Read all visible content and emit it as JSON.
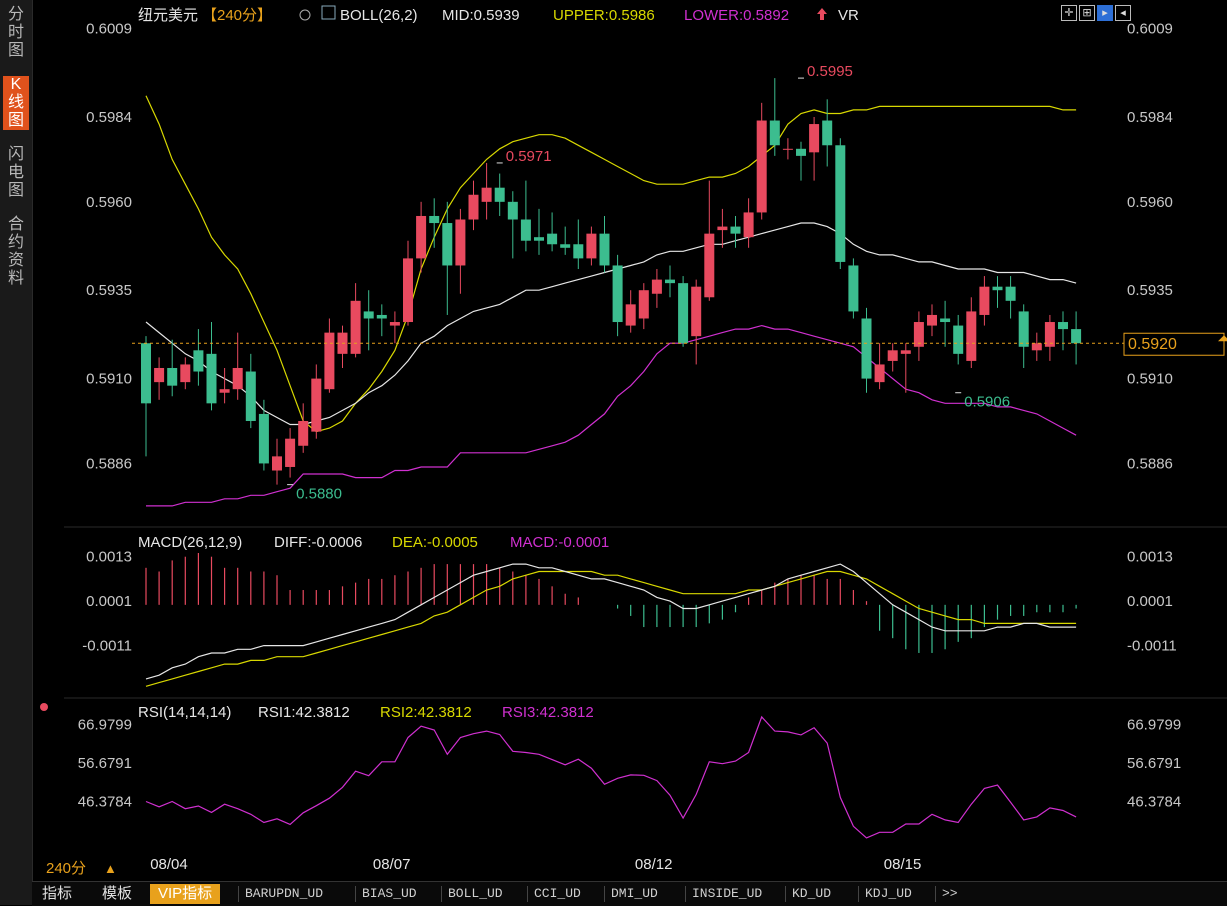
{
  "left_tabs": [
    "分时图",
    "K线图",
    "闪电图",
    "合约资料"
  ],
  "active_tab": "K线图",
  "header": {
    "symbol": "纽元美元",
    "period": "【240分】",
    "boll_label": "BOLL(26,2)",
    "mid": "MID:0.5939",
    "upper": "UPPER:0.5986",
    "lower": "LOWER:0.5892",
    "vr": "VR"
  },
  "macd_header": {
    "label": "MACD(26,12,9)",
    "diff": "DIFF:-0.0006",
    "dea": "DEA:-0.0005",
    "macd": "MACD:-0.0001"
  },
  "rsi_header": {
    "label": "RSI(14,14,14)",
    "rsi1": "RSI1:42.3812",
    "rsi2": "RSI2:42.3812",
    "rsi3": "RSI3:42.3812"
  },
  "period_button": "240分",
  "period_arrow": "▲",
  "current_price": "0.5920",
  "bottom_tabs": [
    "指标",
    "模板",
    "VIP指标",
    "BARUPDN_UD",
    "BIAS_UD",
    "BOLL_UD",
    "CCI_UD",
    "DMI_UD",
    "INSIDE_UD",
    "KD_UD",
    "KDJ_UD",
    ">>"
  ],
  "colors": {
    "up": "#e84a5f",
    "down": "#3cbd8f",
    "upper": "#d8d800",
    "mid": "#e6e6e6",
    "lower": "#d030d0",
    "price_line": "#e8a11c"
  },
  "chart_data": [
    {
      "type": "candlestick",
      "title": "纽元美元【240分】",
      "y_ticks": [
        "0.6009",
        "0.5984",
        "0.5960",
        "0.5935",
        "0.5910",
        "0.5886"
      ],
      "ylim": [
        0.587,
        0.6012
      ],
      "x_tick_labels": [
        {
          "label": "08/04",
          "index": 2
        },
        {
          "label": "08/07",
          "index": 19
        },
        {
          "label": "08/12",
          "index": 39
        },
        {
          "label": "08/15",
          "index": 58
        }
      ],
      "annotations": [
        {
          "text": "0.5995",
          "index": 50,
          "value": 0.5995
        },
        {
          "text": "0.5971",
          "index": 27,
          "value": 0.5971
        },
        {
          "text": "0.5880",
          "index": 11,
          "value": 0.588
        },
        {
          "text": "0.5906",
          "index": 62,
          "value": 0.5906
        }
      ],
      "candles": [
        {
          "o": 0.592,
          "c": 0.5903,
          "h": 0.5922,
          "l": 0.5888
        },
        {
          "o": 0.5909,
          "c": 0.5913,
          "h": 0.5916,
          "l": 0.5904
        },
        {
          "o": 0.5913,
          "c": 0.5908,
          "h": 0.5921,
          "l": 0.5905
        },
        {
          "o": 0.5909,
          "c": 0.5914,
          "h": 0.5916,
          "l": 0.5907
        },
        {
          "o": 0.5918,
          "c": 0.5912,
          "h": 0.5924,
          "l": 0.5908
        },
        {
          "o": 0.5917,
          "c": 0.5903,
          "h": 0.5926,
          "l": 0.5901
        },
        {
          "o": 0.5906,
          "c": 0.5907,
          "h": 0.5913,
          "l": 0.5903
        },
        {
          "o": 0.5907,
          "c": 0.5913,
          "h": 0.5923,
          "l": 0.5904
        },
        {
          "o": 0.5912,
          "c": 0.5898,
          "h": 0.5917,
          "l": 0.5896
        },
        {
          "o": 0.59,
          "c": 0.5886,
          "h": 0.5904,
          "l": 0.5884
        },
        {
          "o": 0.5884,
          "c": 0.5888,
          "h": 0.5893,
          "l": 0.588
        },
        {
          "o": 0.5885,
          "c": 0.5893,
          "h": 0.5896,
          "l": 0.5882
        },
        {
          "o": 0.5891,
          "c": 0.5898,
          "h": 0.5903,
          "l": 0.5889
        },
        {
          "o": 0.5895,
          "c": 0.591,
          "h": 0.5914,
          "l": 0.5893
        },
        {
          "o": 0.5907,
          "c": 0.5923,
          "h": 0.5927,
          "l": 0.5906
        },
        {
          "o": 0.5917,
          "c": 0.5923,
          "h": 0.5925,
          "l": 0.5913
        },
        {
          "o": 0.5917,
          "c": 0.5932,
          "h": 0.5937,
          "l": 0.5916
        },
        {
          "o": 0.5929,
          "c": 0.5927,
          "h": 0.5935,
          "l": 0.5918
        },
        {
          "o": 0.5928,
          "c": 0.5927,
          "h": 0.5931,
          "l": 0.5922
        },
        {
          "o": 0.5925,
          "c": 0.5926,
          "h": 0.5929,
          "l": 0.592
        },
        {
          "o": 0.5926,
          "c": 0.5944,
          "h": 0.5949,
          "l": 0.5925
        },
        {
          "o": 0.5944,
          "c": 0.5956,
          "h": 0.596,
          "l": 0.594
        },
        {
          "o": 0.5956,
          "c": 0.5954,
          "h": 0.5961,
          "l": 0.5947
        },
        {
          "o": 0.5954,
          "c": 0.5942,
          "h": 0.596,
          "l": 0.5928
        },
        {
          "o": 0.5942,
          "c": 0.5955,
          "h": 0.5958,
          "l": 0.5934
        },
        {
          "o": 0.5955,
          "c": 0.5962,
          "h": 0.5966,
          "l": 0.5952
        },
        {
          "o": 0.596,
          "c": 0.5964,
          "h": 0.5971,
          "l": 0.5955
        },
        {
          "o": 0.5964,
          "c": 0.596,
          "h": 0.5968,
          "l": 0.5956
        },
        {
          "o": 0.596,
          "c": 0.5955,
          "h": 0.5963,
          "l": 0.5944
        },
        {
          "o": 0.5955,
          "c": 0.5949,
          "h": 0.5966,
          "l": 0.5946
        },
        {
          "o": 0.595,
          "c": 0.5949,
          "h": 0.5958,
          "l": 0.5945
        },
        {
          "o": 0.5951,
          "c": 0.5948,
          "h": 0.5957,
          "l": 0.5946
        },
        {
          "o": 0.5948,
          "c": 0.5947,
          "h": 0.5953,
          "l": 0.5945
        },
        {
          "o": 0.5948,
          "c": 0.5944,
          "h": 0.5955,
          "l": 0.5941
        },
        {
          "o": 0.5944,
          "c": 0.5951,
          "h": 0.5953,
          "l": 0.5942
        },
        {
          "o": 0.5951,
          "c": 0.5942,
          "h": 0.5956,
          "l": 0.594
        },
        {
          "o": 0.5942,
          "c": 0.5926,
          "h": 0.5945,
          "l": 0.5922
        },
        {
          "o": 0.5925,
          "c": 0.5931,
          "h": 0.5935,
          "l": 0.5923
        },
        {
          "o": 0.5927,
          "c": 0.5935,
          "h": 0.5937,
          "l": 0.5924
        },
        {
          "o": 0.5934,
          "c": 0.5938,
          "h": 0.5941,
          "l": 0.593
        },
        {
          "o": 0.5938,
          "c": 0.5937,
          "h": 0.5942,
          "l": 0.5933
        },
        {
          "o": 0.5937,
          "c": 0.592,
          "h": 0.5939,
          "l": 0.5919
        },
        {
          "o": 0.5922,
          "c": 0.5936,
          "h": 0.5938,
          "l": 0.5914
        },
        {
          "o": 0.5933,
          "c": 0.5951,
          "h": 0.5966,
          "l": 0.5932
        },
        {
          "o": 0.5952,
          "c": 0.5953,
          "h": 0.5958,
          "l": 0.5947
        },
        {
          "o": 0.5953,
          "c": 0.5951,
          "h": 0.5956,
          "l": 0.5947
        },
        {
          "o": 0.595,
          "c": 0.5957,
          "h": 0.5961,
          "l": 0.5947
        },
        {
          "o": 0.5957,
          "c": 0.5983,
          "h": 0.5988,
          "l": 0.5955
        },
        {
          "o": 0.5983,
          "c": 0.5976,
          "h": 0.5995,
          "l": 0.5973
        },
        {
          "o": 0.5975,
          "c": 0.5975,
          "h": 0.5978,
          "l": 0.5972
        },
        {
          "o": 0.5975,
          "c": 0.5973,
          "h": 0.5977,
          "l": 0.5966
        },
        {
          "o": 0.5974,
          "c": 0.5982,
          "h": 0.5984,
          "l": 0.5966
        },
        {
          "o": 0.5983,
          "c": 0.5976,
          "h": 0.5989,
          "l": 0.597
        },
        {
          "o": 0.5976,
          "c": 0.5943,
          "h": 0.5978,
          "l": 0.5941
        },
        {
          "o": 0.5942,
          "c": 0.5929,
          "h": 0.5944,
          "l": 0.5927
        },
        {
          "o": 0.5927,
          "c": 0.591,
          "h": 0.593,
          "l": 0.5906
        },
        {
          "o": 0.5909,
          "c": 0.5914,
          "h": 0.592,
          "l": 0.5907
        },
        {
          "o": 0.5915,
          "c": 0.5918,
          "h": 0.592,
          "l": 0.5912
        },
        {
          "o": 0.5917,
          "c": 0.5918,
          "h": 0.592,
          "l": 0.5906
        },
        {
          "o": 0.5919,
          "c": 0.5926,
          "h": 0.5929,
          "l": 0.5915
        },
        {
          "o": 0.5925,
          "c": 0.5928,
          "h": 0.5931,
          "l": 0.5922
        },
        {
          "o": 0.5927,
          "c": 0.5926,
          "h": 0.5932,
          "l": 0.5919
        },
        {
          "o": 0.5925,
          "c": 0.5917,
          "h": 0.5928,
          "l": 0.5914
        },
        {
          "o": 0.5915,
          "c": 0.5929,
          "h": 0.5933,
          "l": 0.5913
        },
        {
          "o": 0.5928,
          "c": 0.5936,
          "h": 0.5939,
          "l": 0.5925
        },
        {
          "o": 0.5936,
          "c": 0.5935,
          "h": 0.5939,
          "l": 0.593
        },
        {
          "o": 0.5936,
          "c": 0.5932,
          "h": 0.5939,
          "l": 0.5927
        },
        {
          "o": 0.5929,
          "c": 0.5919,
          "h": 0.5931,
          "l": 0.5913
        },
        {
          "o": 0.5918,
          "c": 0.592,
          "h": 0.5923,
          "l": 0.5915
        },
        {
          "o": 0.5919,
          "c": 0.5926,
          "h": 0.5928,
          "l": 0.5915
        },
        {
          "o": 0.5926,
          "c": 0.5924,
          "h": 0.5929,
          "l": 0.5918
        },
        {
          "o": 0.5924,
          "c": 0.592,
          "h": 0.5929,
          "l": 0.5914
        }
      ],
      "boll_upper": [
        0.599,
        0.5982,
        0.5972,
        0.5965,
        0.5958,
        0.595,
        0.5945,
        0.5941,
        0.5934,
        0.5926,
        0.5918,
        0.5908,
        0.5898,
        0.5895,
        0.5896,
        0.5898,
        0.5903,
        0.5907,
        0.5912,
        0.5918,
        0.5928,
        0.5941,
        0.595,
        0.5958,
        0.5964,
        0.5968,
        0.5972,
        0.5975,
        0.5977,
        0.5978,
        0.5979,
        0.5979,
        0.5978,
        0.5976,
        0.5974,
        0.5972,
        0.597,
        0.5968,
        0.5966,
        0.5965,
        0.5965,
        0.5965,
        0.5966,
        0.5967,
        0.5967,
        0.5968,
        0.597,
        0.5973,
        0.5976,
        0.5982,
        0.5985,
        0.5986,
        0.5985,
        0.5985,
        0.5986,
        0.5986,
        0.5987,
        0.5987,
        0.5987,
        0.5987,
        0.5987,
        0.5987,
        0.5987,
        0.5987,
        0.5987,
        0.5987,
        0.5987,
        0.5987,
        0.5987,
        0.5987,
        0.5986,
        0.5986
      ],
      "boll_mid": [
        0.5926,
        0.5923,
        0.592,
        0.5917,
        0.5915,
        0.5912,
        0.591,
        0.5908,
        0.5905,
        0.5901,
        0.5899,
        0.5897,
        0.5897,
        0.5898,
        0.5899,
        0.5901,
        0.5903,
        0.5906,
        0.5908,
        0.5911,
        0.5915,
        0.592,
        0.5922,
        0.5925,
        0.5927,
        0.5929,
        0.593,
        0.5931,
        0.5933,
        0.5935,
        0.5935,
        0.5936,
        0.5937,
        0.5938,
        0.5939,
        0.594,
        0.5941,
        0.5942,
        0.5943,
        0.5945,
        0.5946,
        0.5946,
        0.5947,
        0.5948,
        0.5948,
        0.5949,
        0.595,
        0.5951,
        0.5952,
        0.5953,
        0.5954,
        0.5954,
        0.5953,
        0.5951,
        0.5948,
        0.5946,
        0.5945,
        0.5945,
        0.5944,
        0.5943,
        0.5943,
        0.5942,
        0.5941,
        0.5941,
        0.5941,
        0.594,
        0.594,
        0.594,
        0.5939,
        0.5938,
        0.5938,
        0.5937
      ],
      "boll_lower": [
        0.5874,
        0.5874,
        0.5874,
        0.5875,
        0.5875,
        0.5875,
        0.5876,
        0.5876,
        0.5877,
        0.5877,
        0.5878,
        0.5879,
        0.5883,
        0.5883,
        0.5883,
        0.5883,
        0.5882,
        0.5882,
        0.5882,
        0.5884,
        0.5884,
        0.5885,
        0.5885,
        0.5885,
        0.5889,
        0.5889,
        0.5889,
        0.5889,
        0.5889,
        0.5889,
        0.589,
        0.5891,
        0.5892,
        0.5894,
        0.5897,
        0.59,
        0.5905,
        0.5908,
        0.5912,
        0.5917,
        0.592,
        0.592,
        0.5921,
        0.5922,
        0.5923,
        0.5924,
        0.5924,
        0.5925,
        0.5924,
        0.5924,
        0.5923,
        0.5922,
        0.5921,
        0.592,
        0.5919,
        0.5916,
        0.5913,
        0.591,
        0.5907,
        0.5906,
        0.5904,
        0.5903,
        0.5903,
        0.5903,
        0.5903,
        0.5902,
        0.5902,
        0.5901,
        0.59,
        0.5898,
        0.5896,
        0.5894
      ]
    },
    {
      "type": "macd",
      "title": "MACD(26,12,9)",
      "y_ticks": [
        "0.0013",
        "0.0001",
        "-0.0011"
      ],
      "ylim": [
        -0.0023,
        0.0014
      ],
      "diff": [
        -0.002,
        -0.0019,
        -0.0017,
        -0.0016,
        -0.0014,
        -0.0013,
        -0.0013,
        -0.0012,
        -0.0012,
        -0.0011,
        -0.0011,
        -0.0011,
        -0.0011,
        -0.001,
        -0.0009,
        -0.0008,
        -0.0007,
        -0.0006,
        -0.0005,
        -0.0004,
        -0.0002,
        0.0,
        0.0002,
        0.0004,
        0.0006,
        0.0008,
        0.0009,
        0.001,
        0.0011,
        0.0011,
        0.001,
        0.001,
        0.0009,
        0.0008,
        0.0007,
        0.0007,
        0.0006,
        0.0005,
        0.0004,
        0.0002,
        0.0001,
        -0.0001,
        -0.0001,
        0.0,
        0.0001,
        0.0002,
        0.0003,
        0.0004,
        0.0005,
        0.0007,
        0.0008,
        0.0009,
        0.001,
        0.0011,
        0.0009,
        0.0006,
        0.0003,
        0.0,
        -0.0002,
        -0.0004,
        -0.0006,
        -0.0007,
        -0.0007,
        -0.0007,
        -0.0007,
        -0.0006,
        -0.0006,
        -0.0005,
        -0.0005,
        -0.0006,
        -0.0006,
        -0.0006
      ],
      "dea": [
        -0.0022,
        -0.0021,
        -0.002,
        -0.0019,
        -0.0018,
        -0.0017,
        -0.0016,
        -0.0016,
        -0.0015,
        -0.0015,
        -0.0014,
        -0.0014,
        -0.0014,
        -0.0013,
        -0.0012,
        -0.0011,
        -0.001,
        -0.0009,
        -0.0008,
        -0.0007,
        -0.0006,
        -0.0005,
        -0.0003,
        -0.0002,
        0.0,
        0.0002,
        0.0004,
        0.0005,
        0.0007,
        0.0008,
        0.0009,
        0.0009,
        0.0009,
        0.0009,
        0.0009,
        0.0008,
        0.0008,
        0.0007,
        0.0006,
        0.0005,
        0.0004,
        0.0003,
        0.0003,
        0.0003,
        0.0003,
        0.0003,
        0.0004,
        0.0004,
        0.0005,
        0.0006,
        0.0007,
        0.0008,
        0.0009,
        0.0009,
        0.0008,
        0.0007,
        0.0005,
        0.0003,
        0.0001,
        -0.0001,
        -0.0002,
        -0.0003,
        -0.0004,
        -0.0004,
        -0.0005,
        -0.0005,
        -0.0005,
        -0.0005,
        -0.0005,
        -0.0005,
        -0.0005,
        -0.0005
      ],
      "hist": [
        0.001,
        0.0009,
        0.0012,
        0.0013,
        0.0014,
        0.0013,
        0.001,
        0.001,
        0.0009,
        0.0009,
        0.0008,
        0.0004,
        0.0004,
        0.0004,
        0.0004,
        0.0005,
        0.0006,
        0.0007,
        0.0007,
        0.0008,
        0.0009,
        0.001,
        0.0011,
        0.0011,
        0.0011,
        0.0011,
        0.0011,
        0.001,
        0.0009,
        0.0008,
        0.0007,
        0.0005,
        0.0003,
        0.0002,
        0.0,
        0.0,
        -0.0001,
        -0.0003,
        -0.0006,
        -0.0006,
        -0.0006,
        -0.0006,
        -0.0006,
        -0.0005,
        -0.0004,
        -0.0002,
        0.0002,
        0.0004,
        0.0006,
        0.0007,
        0.0008,
        0.0008,
        0.0007,
        0.0007,
        0.0004,
        0.0001,
        -0.0007,
        -0.0009,
        -0.0012,
        -0.0013,
        -0.0013,
        -0.0012,
        -0.001,
        -0.0009,
        -0.0006,
        -0.0004,
        -0.0003,
        -0.0003,
        -0.0002,
        -0.0002,
        -0.0002,
        -0.0001
      ]
    },
    {
      "type": "line",
      "title": "RSI(14,14,14)",
      "y_ticks": [
        "66.9799",
        "56.6791",
        "46.3784"
      ],
      "ylim": [
        34.0,
        69.5
      ],
      "series": [
        {
          "name": "RSI3",
          "values": [
            46.4,
            45.0,
            46.4,
            44.5,
            45.2,
            43.5,
            45.7,
            44.5,
            43.0,
            40.8,
            41.8,
            40.3,
            43.4,
            45.3,
            47.3,
            50.2,
            54.5,
            53.3,
            57.0,
            57.0,
            63.5,
            66.5,
            65.5,
            59.0,
            63.5,
            64.5,
            65.2,
            64.3,
            59.8,
            59.5,
            59.0,
            57.6,
            56.2,
            57.7,
            55.3,
            51.0,
            52.6,
            53.5,
            53.4,
            52.0,
            48.1,
            42.0,
            48.3,
            57.0,
            56.5,
            57.2,
            59.5,
            69.0,
            65.2,
            65.0,
            64.2,
            66.1,
            62.0,
            47.5,
            39.8,
            36.7,
            38.2,
            38.2,
            40.4,
            40.4,
            43.0,
            41.5,
            40.8,
            45.7,
            49.9,
            50.8,
            46.2,
            41.5,
            42.3,
            44.7,
            44.0,
            42.3
          ]
        }
      ]
    }
  ]
}
